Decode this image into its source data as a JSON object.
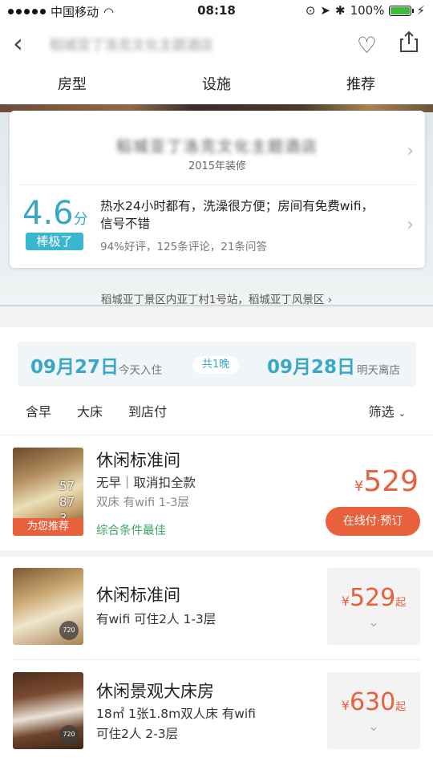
{
  "status": {
    "carrier": "中国移动",
    "time": "08:18",
    "battery": "100%"
  },
  "nav": {
    "title": "稻城亚丁洛克文化主题酒店"
  },
  "tabs": [
    "房型",
    "设施",
    "推荐"
  ],
  "hotel": {
    "name": "稻城亚丁洛克文化主题酒店",
    "renovated": "2015年装修",
    "score": "4.6",
    "score_unit": "分",
    "score_label": "棒极了",
    "review": "热水24小时都有，洗澡很方便；房间有免费wifi，信号不错",
    "stats": "94%好评，125条评论，21条问答",
    "address": "稻城亚丁景区内亚丁村1号站，稻城亚丁风景区"
  },
  "dates": {
    "checkin": "09月27日",
    "checkin_sub": "今天入住",
    "nights": "共1晚",
    "checkout": "09月28日",
    "checkout_sub": "明天离店"
  },
  "filters": {
    "items": [
      "含早",
      "大床",
      "到店付"
    ],
    "filter_label": "筛选"
  },
  "rooms": [
    {
      "name": "休闲标准间",
      "line1": "无早｜取消扣全款",
      "line2": "双床 有wifi 1-3层",
      "line3": "综合条件最佳",
      "price_currency": "¥",
      "price": "529",
      "button": "在线付·预订",
      "tag": "为您推荐",
      "overlay": [
        "57",
        "87",
        "3"
      ]
    },
    {
      "name": "休闲标准间",
      "line1": "有wifi  可住2人  1-3层",
      "price_currency": "¥",
      "price": "529",
      "price_suffix": "起",
      "vr": "720"
    },
    {
      "name": "休闲景观大床房",
      "line1": "18㎡  1张1.8m双人床  有wifi",
      "line2": "可住2人  2-3层",
      "price_currency": "¥",
      "price": "630",
      "price_suffix": "起",
      "vr": "720"
    }
  ],
  "colors": {
    "accent": "#3ba7c7",
    "price": "#e8603c",
    "green": "#3fa763"
  }
}
